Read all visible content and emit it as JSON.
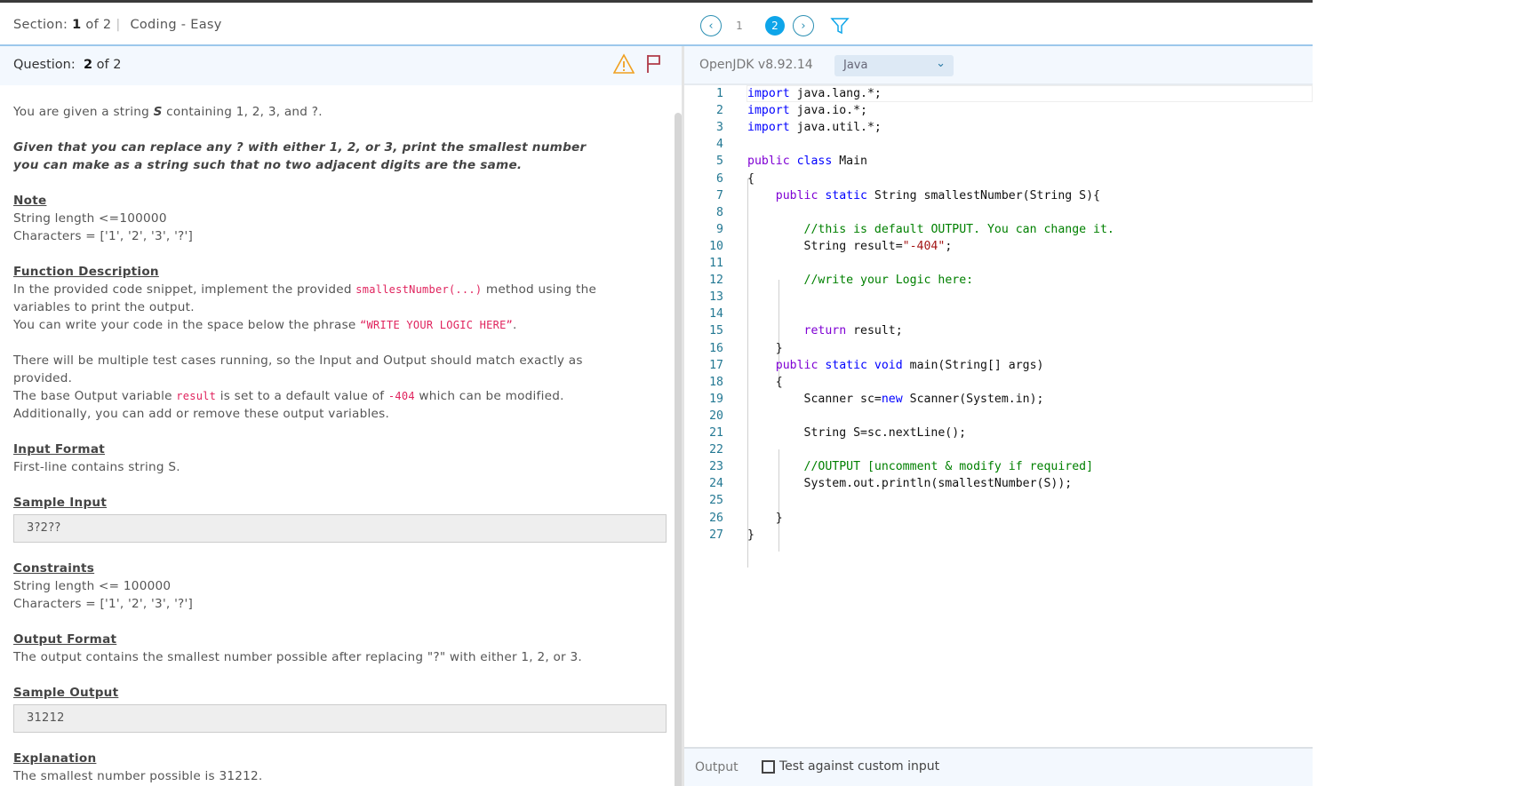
{
  "topbar": {
    "section_label": "Section:",
    "section_current": "1",
    "section_of": "of 2",
    "separator": "|",
    "section_name": "Coding - Easy",
    "pager": {
      "prev": "‹",
      "pages": [
        "1",
        "2"
      ],
      "current": "2",
      "next": "›"
    }
  },
  "question": {
    "label": "Question:",
    "current": "2",
    "of": "of 2"
  },
  "editor": {
    "runtime": "OpenJDK v8.92.14",
    "language": "Java"
  },
  "problem": {
    "intro_a": "You are given a string ",
    "intro_s": "S",
    "intro_b": " containing 1, 2, 3, and ?.",
    "task": "Given that you can replace any ? with either 1, 2, or 3, print the smallest number you can make as a string such that no two adjacent digits are the same.",
    "note_h": "Note",
    "note_1": "String length <=100000",
    "note_2": "Characters = ['1', '2', '3', '?']",
    "func_h": "Function Description",
    "func_1a": "In the provided code snippet, implement the provided ",
    "func_1code": "smallestNumber(...)",
    "func_1b": " method using the variables to print the output.",
    "func_2a": "You can write your code in the space below the phrase ",
    "func_2code": "“WRITE YOUR LOGIC HERE”",
    "func_2b": ".",
    "multi": "There will be multiple test cases running, so the Input and Output should match exactly as provided.",
    "base_a": "The base Output variable ",
    "base_code1": "result",
    "base_b": " is set to a default value of ",
    "base_code2": "-404",
    "base_c": " which can be modified.",
    "additional": "Additionally, you can add or remove these output variables.",
    "input_h": "Input Format",
    "input_t": "First-line contains string S.",
    "sin_h": "Sample Input",
    "sin_v": "3?2??",
    "cons_h": "Constraints",
    "cons_1": "String length <= 100000",
    "cons_2": "Characters = ['1', '2', '3', '?']",
    "out_h": "Output Format",
    "out_t": "The output contains the smallest number possible after replacing \"?\" with either 1, 2, or 3.",
    "sout_h": "Sample Output",
    "sout_v": "31212",
    "exp_h": "Explanation",
    "exp_t": "The smallest number possible is 31212."
  },
  "code": [
    [
      [
        "kw",
        "import"
      ],
      [
        "",
        "java.lang.*;"
      ]
    ],
    [
      [
        "kw",
        "import"
      ],
      [
        "",
        "java.io.*;"
      ]
    ],
    [
      [
        "kw",
        "import"
      ],
      [
        "",
        "java.util.*;"
      ]
    ],
    [],
    [
      [
        "kp",
        "public"
      ],
      [
        "kw",
        "class"
      ],
      [
        "",
        "Main"
      ]
    ],
    [
      [
        "",
        "{"
      ]
    ],
    [
      [
        "",
        "    "
      ],
      [
        "kp",
        "public"
      ],
      [
        "kw",
        "static"
      ],
      [
        "",
        "String smallestNumber(String S){"
      ]
    ],
    [],
    [
      [
        "",
        "        "
      ],
      [
        "cm",
        "//this is default OUTPUT. You can change it."
      ]
    ],
    [
      [
        "",
        "        String result="
      ],
      [
        "st",
        "\"-404\""
      ],
      [
        "",
        ";"
      ]
    ],
    [],
    [
      [
        "",
        "        "
      ],
      [
        "cm",
        "//write your Logic here:"
      ]
    ],
    [],
    [],
    [
      [
        "",
        "        "
      ],
      [
        "kp",
        "return"
      ],
      [
        "",
        "result;"
      ]
    ],
    [
      [
        "",
        "    }"
      ]
    ],
    [
      [
        "",
        "    "
      ],
      [
        "kp",
        "public"
      ],
      [
        "kw",
        "static"
      ],
      [
        "kw",
        "void"
      ],
      [
        "",
        "main(String[] args)"
      ]
    ],
    [
      [
        "",
        "    {"
      ]
    ],
    [
      [
        "",
        "        Scanner sc="
      ],
      [
        "kw",
        "new"
      ],
      [
        "",
        "Scanner(System.in);"
      ]
    ],
    [],
    [
      [
        "",
        "        String S=sc.nextLine();"
      ]
    ],
    [],
    [
      [
        "",
        "        "
      ],
      [
        "cm",
        "//OUTPUT [uncomment & modify if required]"
      ]
    ],
    [
      [
        "",
        "        System.out.println(smallestNumber(S));"
      ]
    ],
    [],
    [
      [
        "",
        "    }"
      ]
    ],
    [
      [
        "",
        "}"
      ]
    ]
  ],
  "output": {
    "label": "Output",
    "custom_input_label": "Test against custom input",
    "custom_input_checked": false
  },
  "colors": {
    "accent": "#0ea5e9",
    "warning": "#f0a020",
    "flag": "#b03a48"
  }
}
